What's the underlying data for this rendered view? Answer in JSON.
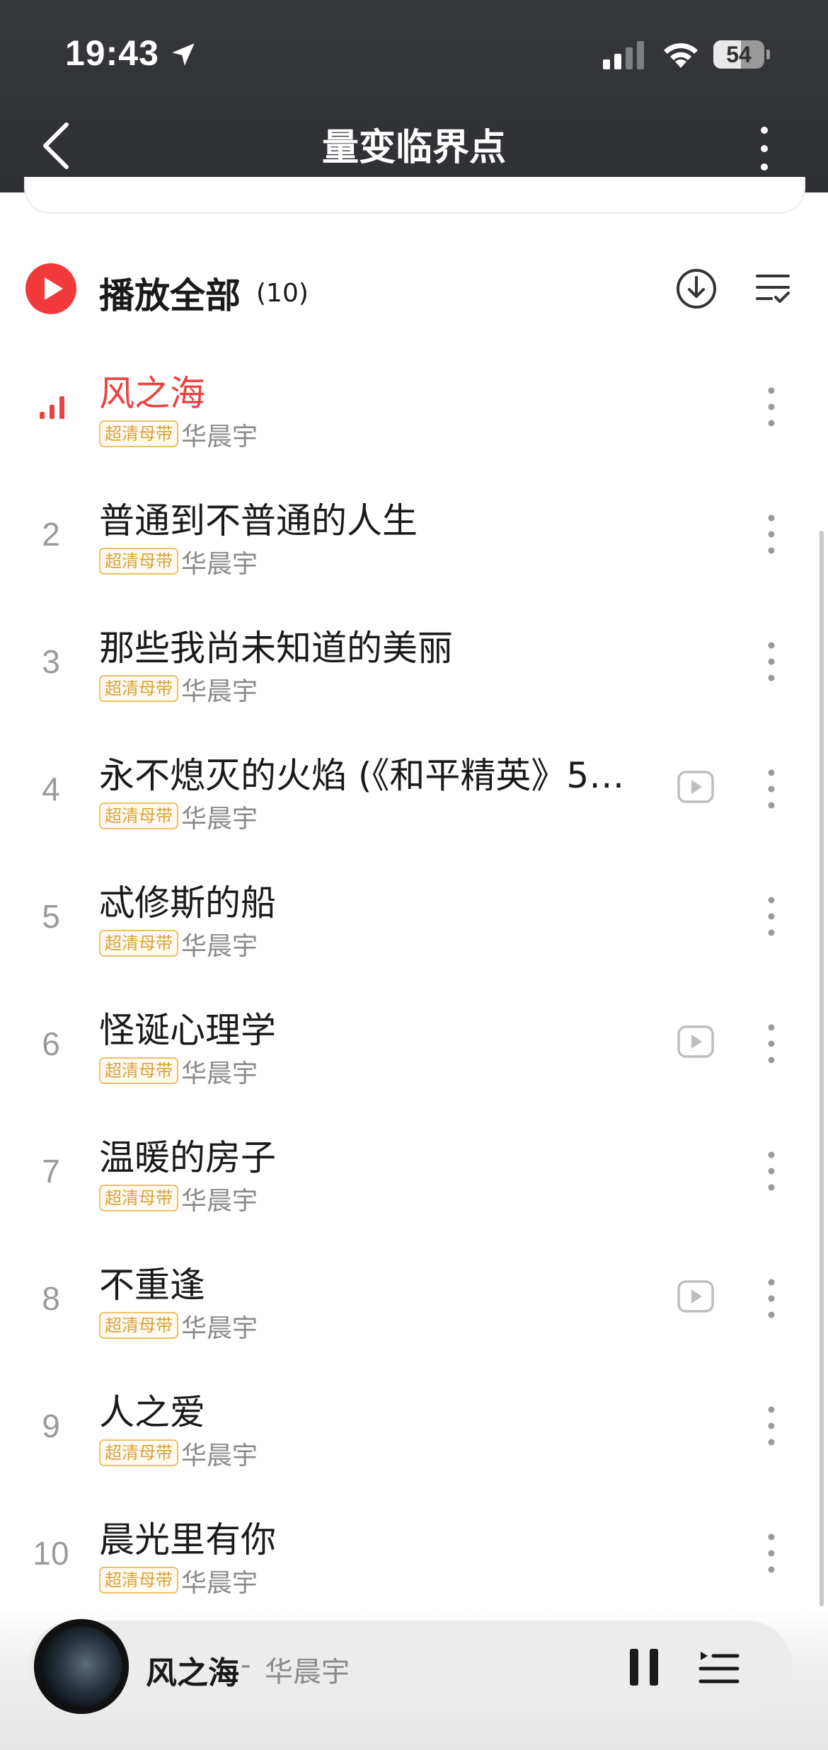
{
  "status_bar": {
    "time": "19:43",
    "battery": "54",
    "battery_level": 0.54,
    "icons": [
      "location-arrow-icon",
      "signal-icon",
      "wifi-icon",
      "battery-icon"
    ]
  },
  "nav": {
    "title": "量变临界点",
    "back_icon": "chevron-left-icon",
    "more_icon": "vertical-dots-icon"
  },
  "play_all": {
    "label": "播放全部",
    "count": "(10)",
    "icons": [
      "play-icon",
      "download-icon",
      "multi-select-icon"
    ]
  },
  "songs": [
    {
      "index": "",
      "title": "风之海",
      "badge": "超清母带",
      "artist": "华晨宇",
      "playing": true,
      "has_mv": false
    },
    {
      "index": "2",
      "title": "普通到不普通的人生",
      "badge": "超清母带",
      "artist": "华晨宇",
      "playing": false,
      "has_mv": false
    },
    {
      "index": "3",
      "title": "那些我尚未知道的美丽",
      "badge": "超清母带",
      "artist": "华晨宇",
      "playing": false,
      "has_mv": false
    },
    {
      "index": "4",
      "title": "永不熄灭的火焰 (《和平精英》5…",
      "badge": "超清母带",
      "artist": "华晨宇",
      "playing": false,
      "has_mv": true
    },
    {
      "index": "5",
      "title": "忒修斯的船",
      "badge": "超清母带",
      "artist": "华晨宇",
      "playing": false,
      "has_mv": false
    },
    {
      "index": "6",
      "title": "怪诞心理学",
      "badge": "超清母带",
      "artist": "华晨宇",
      "playing": false,
      "has_mv": true
    },
    {
      "index": "7",
      "title": "温暖的房子",
      "badge": "超清母带",
      "artist": "华晨宇",
      "playing": false,
      "has_mv": false
    },
    {
      "index": "8",
      "title": "不重逢",
      "badge": "超清母带",
      "artist": "华晨宇",
      "playing": false,
      "has_mv": true
    },
    {
      "index": "9",
      "title": "人之爱",
      "badge": "超清母带",
      "artist": "华晨宇",
      "playing": false,
      "has_mv": false
    },
    {
      "index": "10",
      "title": "晨光里有你",
      "badge": "超清母带",
      "artist": "华晨宇",
      "playing": false,
      "has_mv": false
    }
  ],
  "mini_player": {
    "title": "风之海",
    "separator": "-",
    "artist": "华晨宇",
    "icons": [
      "album-cover",
      "pause-icon",
      "playlist-icon"
    ]
  },
  "colors": {
    "header_bg": "#2e3033",
    "accent_red": "#ec4141",
    "badge_gold": "#d9a23b",
    "secondary_text": "#8a8a8a"
  }
}
